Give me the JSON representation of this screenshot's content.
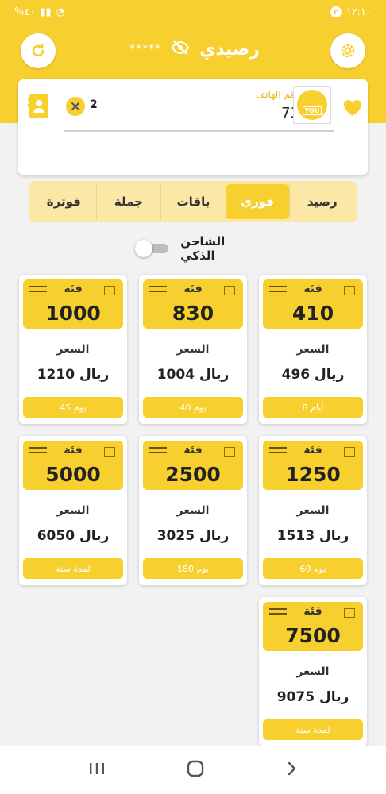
{
  "status_bar": {
    "time": "١٢:١٠",
    "notification_count": "٢",
    "battery": "%٤٠"
  },
  "header": {
    "title": "رصيدي",
    "masked_balance": "*****"
  },
  "account": {
    "phone_label": "رقم الهاتف",
    "phone_value": "73",
    "count": "2",
    "logo_text": "YOU"
  },
  "tabs": [
    {
      "label": "رصيد",
      "active": false
    },
    {
      "label": "فوري",
      "active": true
    },
    {
      "label": "باقات",
      "active": false
    },
    {
      "label": "جملة",
      "active": false
    },
    {
      "label": "فوترة",
      "active": false
    }
  ],
  "smart_charger": {
    "label": "الشاحن الذكي",
    "enabled": false
  },
  "offers": [
    {
      "group_label": "فئة",
      "value": "410",
      "price_label": "السعر",
      "price": "496 ريال",
      "validity": "8 أيام"
    },
    {
      "group_label": "فئة",
      "value": "830",
      "price_label": "السعر",
      "price": "1004 ريال",
      "validity": "40 يوم"
    },
    {
      "group_label": "فئة",
      "value": "1000",
      "price_label": "السعر",
      "price": "1210 ريال",
      "validity": "45 يوم"
    },
    {
      "group_label": "فئة",
      "value": "1250",
      "price_label": "السعر",
      "price": "1513 ريال",
      "validity": "60 يوم"
    },
    {
      "group_label": "فئة",
      "value": "2500",
      "price_label": "السعر",
      "price": "3025 ريال",
      "validity": "180 يوم"
    },
    {
      "group_label": "فئة",
      "value": "5000",
      "price_label": "السعر",
      "price": "6050 ريال",
      "validity": "لمدة سنة"
    },
    {
      "group_label": "فئة",
      "value": "7500",
      "price_label": "السعر",
      "price": "9075 ريال",
      "validity": "لمدة سنة"
    }
  ],
  "colors": {
    "brand_yellow": "#f7cf2f",
    "tab_bg": "#fbe7a6",
    "page_bg": "#f2f2f2"
  },
  "icons": {
    "refresh": "refresh-icon",
    "settings": "gear-icon",
    "visibility": "eye-off-icon",
    "contacts": "contact-card-icon",
    "clear": "close-circle-icon",
    "favorite": "heart-icon",
    "nav_recent": "recent-apps-icon",
    "nav_home": "home-icon",
    "nav_back": "back-chevron-icon"
  }
}
